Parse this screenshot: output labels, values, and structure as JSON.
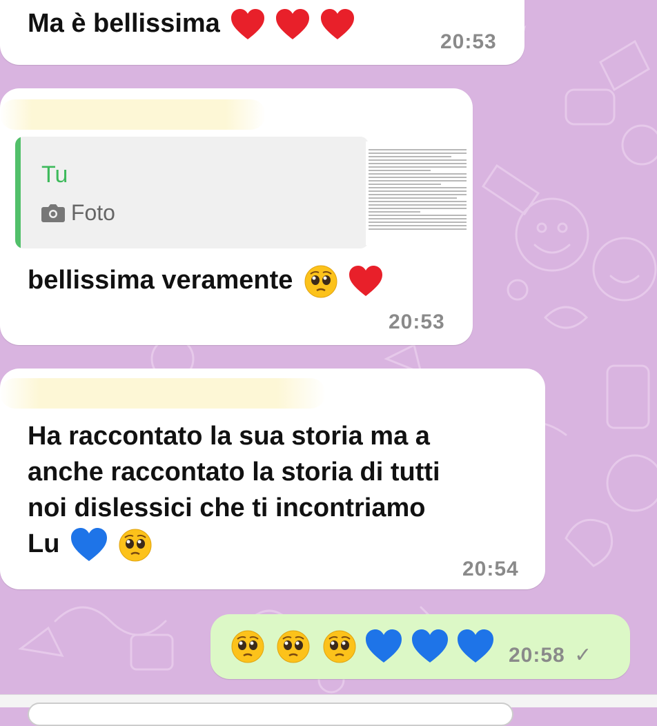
{
  "messages": [
    {
      "direction": "in",
      "text": "Ma è bellissima",
      "emojis": [
        "heart-red",
        "heart-red",
        "heart-red"
      ],
      "time": "20:53"
    },
    {
      "direction": "in",
      "reply": {
        "author": "Tu",
        "type": "Foto"
      },
      "text": "bellissima veramente",
      "emojis": [
        "pleading-face",
        "heart-red"
      ],
      "time": "20:53"
    },
    {
      "direction": "in",
      "lines": [
        "Ha raccontato la sua storia ma a",
        "anche raccontato la storia di tutti",
        "noi dislessici che ti incontriamo",
        "Lu"
      ],
      "emojis": [
        "heart-blue",
        "pleading-face"
      ],
      "time": "20:54"
    },
    {
      "direction": "out",
      "emojis": [
        "pleading-face",
        "pleading-face",
        "pleading-face",
        "heart-blue",
        "heart-blue",
        "heart-blue"
      ],
      "time": "20:58",
      "status": "✓"
    }
  ],
  "colors": {
    "wallpaper": "#d9b4e0",
    "incoming": "#ffffff",
    "outgoing": "#dcf8c6",
    "reply_accent": "#3dba5b"
  },
  "icons": {
    "reply_type": "camera-icon",
    "read_status": "single-check-icon"
  }
}
